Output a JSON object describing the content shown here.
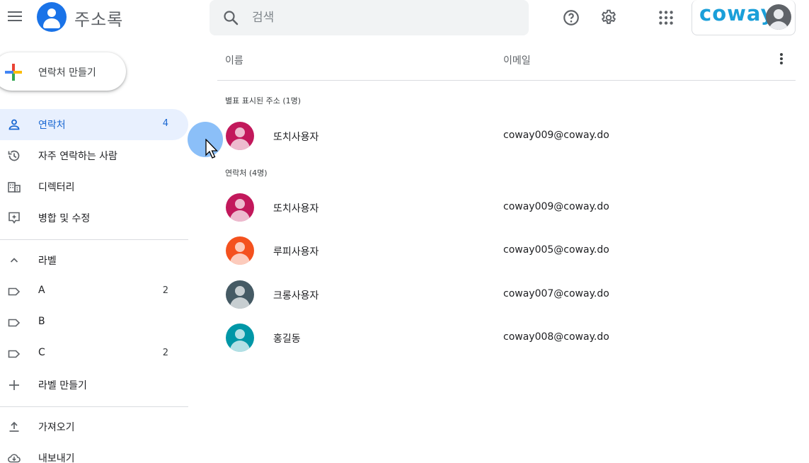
{
  "header": {
    "app_title": "주소록",
    "search_placeholder": "검색",
    "brand": "coway",
    "icons": [
      "menu-icon",
      "search-icon",
      "help-icon",
      "gear-icon",
      "apps-icon"
    ]
  },
  "sidebar": {
    "create_label": "연락처 만들기",
    "nav": [
      {
        "label": "연락처",
        "count": "4",
        "icon": "person-icon",
        "active": true
      },
      {
        "label": "자주 연락하는 사람",
        "count": "",
        "icon": "history-icon"
      },
      {
        "label": "디렉터리",
        "count": "",
        "icon": "building-icon"
      },
      {
        "label": "병합 및 수정",
        "count": "",
        "icon": "merge-icon"
      }
    ],
    "labels_header": "라벨",
    "labels": [
      {
        "label": "A",
        "count": "2"
      },
      {
        "label": "B",
        "count": ""
      },
      {
        "label": "C",
        "count": "2"
      }
    ],
    "create_label_item": "라벨 만들기",
    "import_label": "가져오기",
    "export_label": "내보내기"
  },
  "list": {
    "col_name": "이름",
    "col_email": "이메일",
    "starred_section": "별표 표시된 주소 (1명)",
    "contacts_section": "연락처 (4명)",
    "starred": [
      {
        "name": "또치사용자",
        "email": "coway009@coway.do",
        "color": "#c2185b"
      }
    ],
    "contacts": [
      {
        "name": "또치사용자",
        "email": "coway009@coway.do",
        "color": "#c2185b"
      },
      {
        "name": "루피사용자",
        "email": "coway005@coway.do",
        "color": "#f4511e"
      },
      {
        "name": "크롱사용자",
        "email": "coway007@coway.do",
        "color": "#455a64"
      },
      {
        "name": "홍길동",
        "email": "coway008@coway.do",
        "color": "#0097a7"
      }
    ]
  }
}
